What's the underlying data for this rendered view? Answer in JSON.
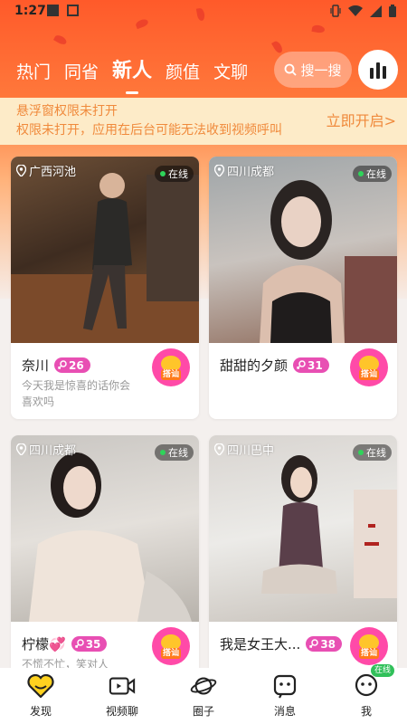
{
  "status": {
    "time": "1:27"
  },
  "tabs": [
    {
      "label": "热门"
    },
    {
      "label": "同省"
    },
    {
      "label": "新人",
      "active": true
    },
    {
      "label": "颜值"
    },
    {
      "label": "文聊"
    }
  ],
  "search": {
    "label": "搜一搜",
    "icon": "search-icon"
  },
  "rank": {
    "icon": "bar-chart-icon"
  },
  "notice": {
    "line1": "悬浮窗权限未打开",
    "line2": "权限未打开，应用在后台可能无法收到视频呼叫",
    "action": "立即开启>"
  },
  "cards": [
    {
      "location": "广西河池",
      "online": "在线",
      "name": "奈川",
      "badge": "26",
      "signature": "今天我是惊喜的话你会喜欢吗",
      "call": "搭讪"
    },
    {
      "location": "四川成都",
      "online": "在线",
      "name": "甜甜的夕颜",
      "badge": "31",
      "signature": "",
      "call": "搭讪"
    },
    {
      "location": "四川成都",
      "online": "在线",
      "name": "柠檬💞",
      "badge": "35",
      "signature": "不慌不忙，笑对人",
      "call": "搭讪"
    },
    {
      "location": "四川巴中",
      "online": "在线",
      "name": "我是女王大...",
      "badge": "38",
      "signature": "",
      "call": "搭讪"
    }
  ],
  "nav": [
    {
      "label": "发现",
      "icon": "heart-icon"
    },
    {
      "label": "视频聊",
      "icon": "video-icon"
    },
    {
      "label": "圈子",
      "icon": "planet-icon"
    },
    {
      "label": "消息",
      "icon": "message-icon"
    },
    {
      "label": "我",
      "icon": "profile-icon",
      "badge": "在线"
    }
  ],
  "colors": {
    "accent": "#ff5a2a",
    "badge": "#e84fb3",
    "online": "#2fd35a",
    "notice_text": "#f08a3c"
  }
}
